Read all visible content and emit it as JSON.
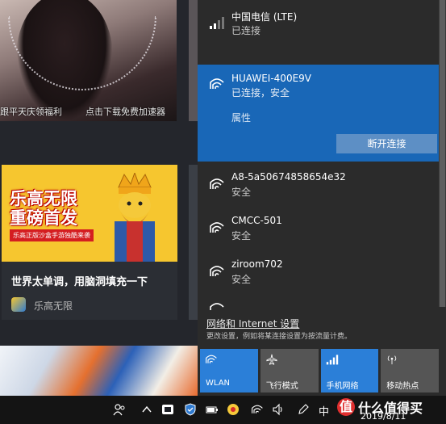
{
  "background": {
    "caption_left": "跟平天庆领福利",
    "caption_right": "点击下载免费加速器",
    "game_card": {
      "logo_line1": "乐高无限",
      "logo_line2": "重磅首发",
      "logo_sub": "乐高正版沙盒手游独酷来袭",
      "title": "世界太单调，用脑洞填充一下",
      "source": "乐高无限"
    }
  },
  "network_flyout": {
    "networks": [
      {
        "name": "中国电信 (LTE)",
        "status": "已连接",
        "icon": "cellular-signal-icon"
      },
      {
        "name": "HUAWEI-400E9V",
        "status": "已连接，安全",
        "icon": "wifi-icon",
        "active": true
      },
      {
        "name": "A8-5a50674858654e32",
        "status": "安全",
        "icon": "wifi-icon"
      },
      {
        "name": "CMCC-501",
        "status": "安全",
        "icon": "wifi-icon"
      },
      {
        "name": "ziroom702",
        "status": "安全",
        "icon": "wifi-icon"
      }
    ],
    "properties_label": "属性",
    "disconnect_label": "断开连接",
    "settings_title": "网络和 Internet 设置",
    "settings_desc": "更改设置，例如将某连接设置为按流量计费。",
    "quick_actions": [
      {
        "label": "WLAN",
        "icon": "wifi-icon",
        "on": true
      },
      {
        "label": "飞行模式",
        "icon": "airplane-icon",
        "on": false
      },
      {
        "label": "手机网络",
        "icon": "cellular-signal-icon",
        "on": true
      },
      {
        "label": "移动热点",
        "icon": "hotspot-icon",
        "on": false
      }
    ]
  },
  "taskbar": {
    "ime_label": "中",
    "date": "2019/8/11"
  },
  "watermark": {
    "logo": "值",
    "text": "什么值得买"
  },
  "colors": {
    "accent": "#1967b7",
    "tile_on": "#2b7fd8",
    "tile_off": "#555555"
  }
}
